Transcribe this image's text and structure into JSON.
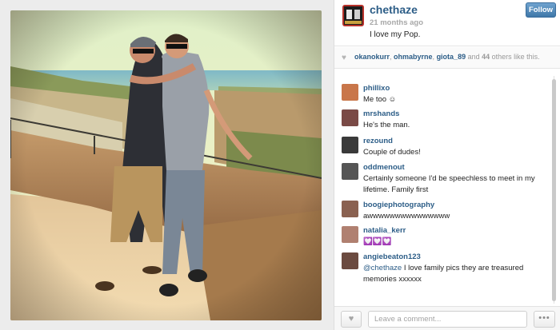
{
  "post": {
    "owner": "chethaze",
    "time_ago": "21 months ago",
    "caption": "I love my Pop.",
    "follow_label": "Follow"
  },
  "likes": {
    "users": [
      "okanokurr",
      "ohmabyrne",
      "giota_89"
    ],
    "separator": ", ",
    "and_text": " and ",
    "count": "44",
    "suffix": " others like this."
  },
  "comments": [
    {
      "user": "phillixo",
      "text": "Me too ☺",
      "avatar_color": "#c9764a"
    },
    {
      "user": "mrshands",
      "text": "He's the man.",
      "avatar_color": "#7a4a46"
    },
    {
      "user": "rezound",
      "text": "Couple of dudes!",
      "avatar_color": "#3a3a3a"
    },
    {
      "user": "oddmenout",
      "text": "Certainly someone I'd be speechless to meet in my lifetime. Family first",
      "avatar_color": "#555555"
    },
    {
      "user": "boogiephotography",
      "text": "awwwwwwwwwwwwwww",
      "avatar_color": "#8a6150"
    },
    {
      "user": "natalia_kerr",
      "text": "💟💟💟",
      "avatar_color": "#b08070"
    },
    {
      "user": "angiebeaton123",
      "mention": "@chethaze",
      "text": " I love family pics they are treasured memories xxxxxx",
      "avatar_color": "#6b4a3f"
    }
  ],
  "composer": {
    "placeholder": "Leave a comment...",
    "like_icon": "heart-icon",
    "more_icon": "ellipsis-icon"
  },
  "colors": {
    "link_blue": "#2c5d87",
    "follow_button": "#4a82b4"
  }
}
